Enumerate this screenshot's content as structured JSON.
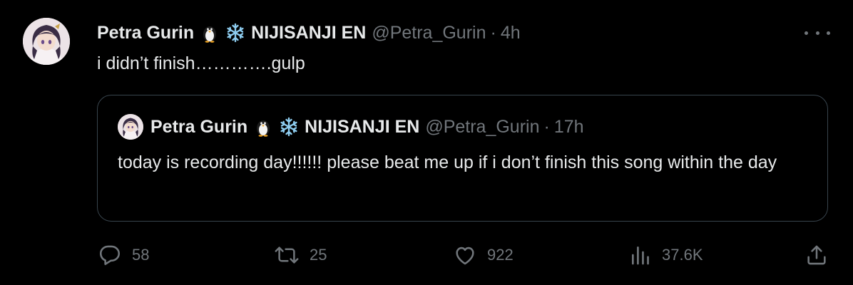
{
  "tweet": {
    "author": {
      "name": "Petra Gurin",
      "name_suffix": "NIJISANJI EN",
      "handle": "@Petra_Gurin",
      "time": "4h",
      "emojis": [
        "penguin-emoji",
        "snowflake-emoji"
      ]
    },
    "separator": "·",
    "text": "i didn’t finish………….gulp",
    "quoted": {
      "author": {
        "name": "Petra Gurin",
        "name_suffix": "NIJISANJI EN",
        "handle": "@Petra_Gurin",
        "time": "17h"
      },
      "text": "today is recording day!!!!!! please beat me up if i don’t finish this song within the day"
    },
    "actions": {
      "replies": "58",
      "retweets": "25",
      "likes": "922",
      "views": "37.6K"
    },
    "icons": [
      "more-icon",
      "reply-icon",
      "retweet-icon",
      "like-icon",
      "views-icon",
      "share-icon"
    ]
  },
  "colors": {
    "background": "#000000",
    "primary_text": "#e7e9ea",
    "secondary_text": "#71767b",
    "border": "#38444d",
    "snowflake": "#8ecdf0"
  }
}
